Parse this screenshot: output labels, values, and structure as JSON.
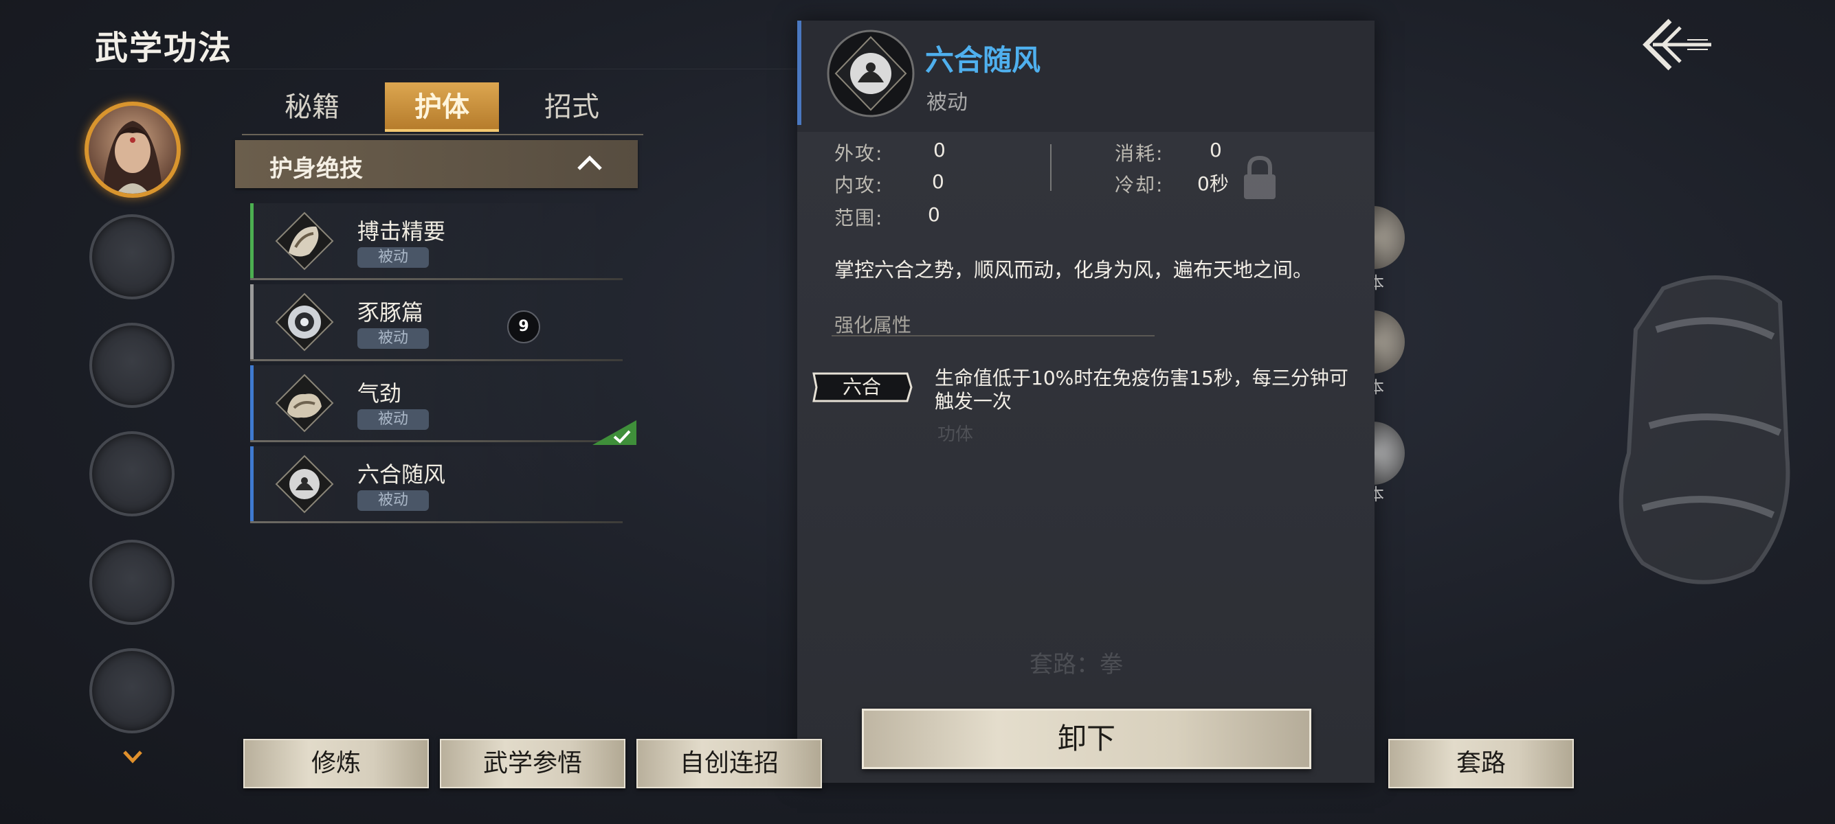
{
  "header": {
    "title": "武学功法"
  },
  "tabs": [
    {
      "label": "秘籍"
    },
    {
      "label": "护体"
    },
    {
      "label": "招式"
    }
  ],
  "category": {
    "label": "护身绝技"
  },
  "skills": [
    {
      "name": "搏击精要",
      "tag": "被动",
      "accent": "#4caf50"
    },
    {
      "name": "豕豚篇",
      "tag": "被动",
      "accent": "#9a9a9a",
      "level": "9"
    },
    {
      "name": "气劲",
      "tag": "被动",
      "accent": "#3f7ad0",
      "equipped": true
    },
    {
      "name": "六合随风",
      "tag": "被动",
      "accent": "#3f7ad0"
    }
  ],
  "detail": {
    "name": "六合随风",
    "type": "被动",
    "stats": {
      "outer_attack_label": "外攻:",
      "outer_attack": "0",
      "inner_attack_label": "内攻:",
      "inner_attack": "0",
      "range_label": "范围:",
      "range": "0",
      "cost_label": "消耗:",
      "cost": "0",
      "cooldown_label": "冷却:",
      "cooldown": "0秒"
    },
    "description": "掌控六合之势，顺风而动，化身为风，遍布天地之间。",
    "enhance_title": "强化属性",
    "enhance_tag": "六合",
    "enhance_text_line1": "生命值低于10%时在免疫伤害15秒，每三分钟可",
    "enhance_text_line2": "触发一次",
    "unload_label": "卸下"
  },
  "ghost_text": {
    "gongti": "功体",
    "route": "套路：拳",
    "side1": "本",
    "side2": "本",
    "side3": "本"
  },
  "bottom": {
    "practice": "修炼",
    "insight": "武学参悟",
    "combo": "自创连招",
    "route": "套路"
  },
  "colors": {
    "accent_gold": "#d9952e",
    "detail_name": "#4fb0ee",
    "tag_bg": "#4a5667"
  }
}
